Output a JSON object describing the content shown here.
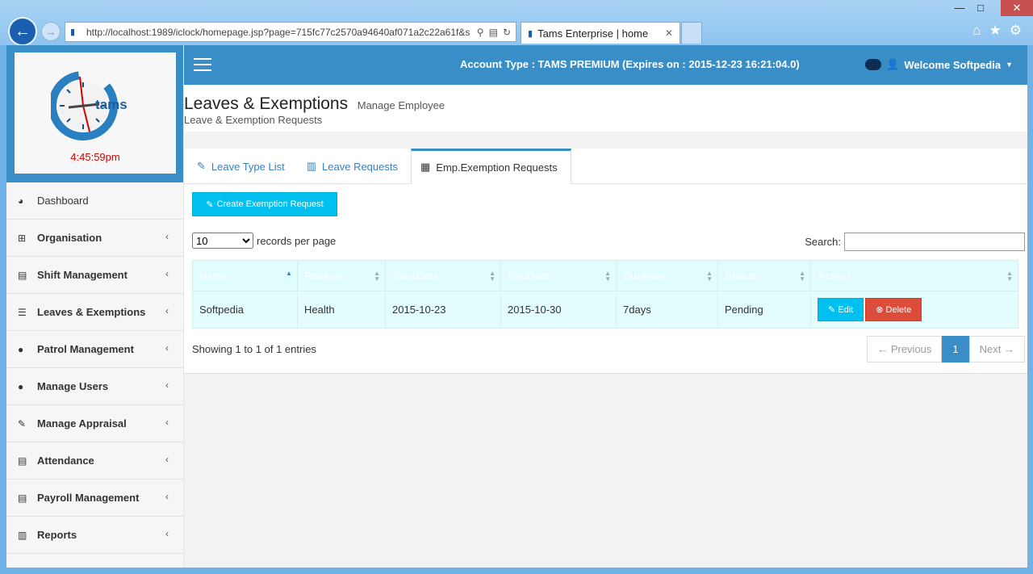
{
  "browser": {
    "url": "http://localhost:1989/iclock/homepage.jsp?page=715fc77c2570a94640af071a2c22a61f&s",
    "tab_title": "Tams Enterprise | home"
  },
  "logo": {
    "text": "tams",
    "time": "4:45:59pm"
  },
  "sidebar": {
    "items": [
      {
        "label": "Dashboard",
        "icon": "dashboard-icon"
      },
      {
        "label": "Organisation",
        "icon": "sitemap-icon"
      },
      {
        "label": "Shift Management",
        "icon": "list-icon"
      },
      {
        "label": "Leaves & Exemptions",
        "icon": "bars-icon"
      },
      {
        "label": "Patrol Management",
        "icon": "user-icon"
      },
      {
        "label": "Manage Users",
        "icon": "user-icon"
      },
      {
        "label": "Manage Appraisal",
        "icon": "edit-icon"
      },
      {
        "label": "Attendance",
        "icon": "list-icon"
      },
      {
        "label": "Payroll Management",
        "icon": "list-icon"
      },
      {
        "label": "Reports",
        "icon": "chart-icon"
      }
    ]
  },
  "topbar": {
    "account": "Account Type : TAMS PREMIUM (Expires on : 2015-12-23 16:21:04.0)",
    "welcome": "Welcome Softpedia"
  },
  "header": {
    "title": "Leaves & Exemptions",
    "subtitle": "Manage Employee",
    "breadcrumb": "Leave & Exemption Requests"
  },
  "tabs": [
    {
      "label": "Leave Type List",
      "icon": "edit-icon"
    },
    {
      "label": "Leave Requests",
      "icon": "barcode-icon"
    },
    {
      "label": "Emp.Exemption Requests",
      "icon": "calendar-icon"
    }
  ],
  "create_button": "Create Exemption Request",
  "length": {
    "value": "10",
    "suffix": "records per page"
  },
  "search": {
    "label": "Search:",
    "value": ""
  },
  "table": {
    "columns": [
      "Name",
      "Reason",
      "StartDate",
      "EndDate",
      "Duration",
      "Status",
      "Action"
    ],
    "rows": [
      {
        "name": "Softpedia",
        "reason": "Health",
        "start": "2015-10-23",
        "end": "2015-10-30",
        "duration": "7days",
        "status": "Pending"
      }
    ],
    "edit_label": "Edit",
    "delete_label": "Delete"
  },
  "info": "Showing 1 to 1 of 1 entries",
  "pager": {
    "previous": "← Previous",
    "current": "1",
    "next": "Next →"
  },
  "colors": {
    "primary": "#3a8ec7",
    "info_button": "#00c0ef",
    "danger_button": "#dd4b39",
    "table_row": "#e3fcfc"
  }
}
